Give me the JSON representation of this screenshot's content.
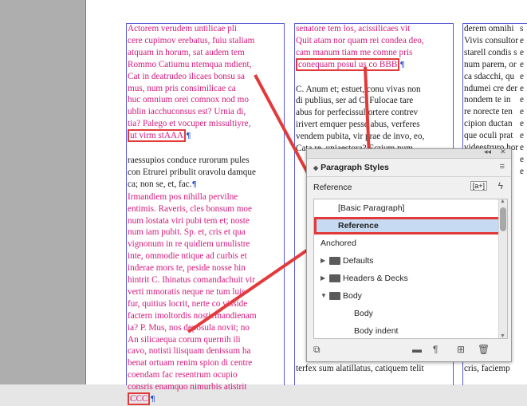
{
  "document": {
    "col1_text": [
      {
        "t": "Actorem verudem untilicae pli",
        "c": "pink"
      },
      {
        "t": "cere cupimov erebatus, fuiu staliam",
        "c": "pink"
      },
      {
        "t": "atquam in horum, sat audem tem",
        "c": "pink"
      },
      {
        "t": "Rommo Catiumu ntemqua mdient,",
        "c": "pink"
      },
      {
        "t": "Cat in deatrudeo ilicaes bonsu sa",
        "c": "pink"
      },
      {
        "t": "mus, num pris consimilicae ca",
        "c": "pink"
      },
      {
        "t": "huc omnium orei comnox nod mo",
        "c": "pink"
      },
      {
        "t": "ublin iacchuconsus est? Urnia di,",
        "c": "pink"
      },
      {
        "t": "tia? Palego et vocuper missultiyre,",
        "c": "pink"
      },
      {
        "t": "ut virm stAAA",
        "c": "pink",
        "tag": true
      },
      {
        "t": "",
        "c": "black"
      },
      {
        "t": "raessupios conduce rurorum pules",
        "c": "black"
      },
      {
        "t": "con Etrurei pribulit oravolu damque",
        "c": "black"
      },
      {
        "t": "ca; non se, et, fac.",
        "c": "black",
        "mark": true
      },
      {
        "t": "Irmandiem pos nihilla pervilne",
        "c": "pink"
      },
      {
        "t": "entimis. Raveris, cles bonsum moe",
        "c": "pink"
      },
      {
        "t": "num lostata viri pubi tem et; noste",
        "c": "pink"
      },
      {
        "t": "num iam pubit. Sp. et, cris et qua",
        "c": "pink"
      },
      {
        "t": "vignonum in re quidiem urnulistre",
        "c": "pink"
      },
      {
        "t": "inte, ommodie ntique ad curbis et",
        "c": "pink"
      },
      {
        "t": "inderae mors te, peside nosse hin",
        "c": "pink"
      },
      {
        "t": "hintrit C. Ihinatus comandachuit vir",
        "c": "pink"
      },
      {
        "t": "verti mmoratis neque ne tum luis",
        "c": "pink"
      },
      {
        "t": "fur, quitius locrit, nerte co visside",
        "c": "pink"
      },
      {
        "t": "factern imoltordis nostiemandienam",
        "c": "pink"
      },
      {
        "t": "ia? P. Mus, nos deposula novit; no",
        "c": "pink"
      },
      {
        "t": "An silicaequa corum quernih ili",
        "c": "pink"
      },
      {
        "t": "cavo, notisti liisquam denissum ha",
        "c": "pink"
      },
      {
        "t": "benat ortuam renim spion di centre",
        "c": "pink"
      },
      {
        "t": "coendam fac resentrum ocupio",
        "c": "pink"
      },
      {
        "t": "consris enamquo nimurbis atistrit",
        "c": "pink"
      },
      {
        "t": "CCC",
        "c": "pink",
        "tag": true
      }
    ],
    "col2_text": [
      {
        "t": "senatore tem los, acissilicaes vit",
        "c": "pink"
      },
      {
        "t": "Quit atam nor quam rei condea deo,",
        "c": "pink"
      },
      {
        "t": "cam manum tiam me comne pris",
        "c": "pink"
      },
      {
        "t": "conequam posul us co BBB",
        "c": "pink",
        "tag": true
      },
      {
        "t": "",
        "c": "black"
      },
      {
        "t": "C. Anum et; estuet, conu vivas non",
        "c": "black"
      },
      {
        "t": "di publius, ser ad C. Fulocae tare",
        "c": "black"
      },
      {
        "t": "abus for perfecissultortere contrev",
        "c": "black"
      },
      {
        "t": "irivert emquer pesse abus, verferes",
        "c": "black"
      },
      {
        "t": "vendem pubita, vir prae de invo, eo,",
        "c": "black"
      },
      {
        "t": "Cata re, uniaestora? Ecrium num",
        "c": "black"
      }
    ],
    "col2_bottom": "terfex sum alatillatus, catiquem telit",
    "col3_text": [
      {
        "t": "derem omnihi",
        "c": "black"
      },
      {
        "t": "Vivis consultor",
        "c": "black"
      },
      {
        "t": "starell condis s",
        "c": "black"
      },
      {
        "t": "num parem, or",
        "c": "black"
      },
      {
        "t": "ca sdacchi, qu",
        "c": "black"
      },
      {
        "t": "ndumei cre der",
        "c": "black"
      },
      {
        "t": "nondem te in",
        "c": "black"
      },
      {
        "t": "re norecte ten",
        "c": "black"
      },
      {
        "t": "cipion ductan",
        "c": "black"
      },
      {
        "t": "que oculi prat",
        "c": "black"
      },
      {
        "t": "videestruro hor",
        "c": "black"
      }
    ],
    "col3_bottom": "cris, faciemp",
    "col4_letters": [
      "s",
      "e",
      "e",
      "e",
      "e",
      "e",
      "e",
      "e",
      "e",
      "e",
      "e",
      "e",
      "e"
    ]
  },
  "panel": {
    "collapse_glyph": "◂◂",
    "close_glyph": "✕",
    "title": "Paragraph Styles",
    "menu_glyph": "≡",
    "current_style": "Reference",
    "new_style_btn": "[a+]",
    "bolt_glyph": "ϟ",
    "items": [
      {
        "label": "[Basic Paragraph]",
        "indent": 30,
        "type": "style"
      },
      {
        "label": "Reference",
        "indent": 30,
        "type": "style",
        "selected": true
      },
      {
        "label": "Anchored",
        "indent": 8,
        "type": "style"
      },
      {
        "label": "Defaults",
        "indent": 36,
        "type": "folder",
        "chevron": "▶"
      },
      {
        "label": "Headers & Decks",
        "indent": 36,
        "type": "folder",
        "chevron": "▶"
      },
      {
        "label": "Body",
        "indent": 36,
        "type": "folder",
        "chevron": "▼"
      },
      {
        "label": "Body",
        "indent": 50,
        "type": "style"
      },
      {
        "label": "Body indent",
        "indent": 50,
        "type": "style"
      }
    ],
    "footer_icons": [
      "⧉",
      "▬",
      "¶",
      "⊞",
      "🗑"
    ],
    "accent_color": "#c6daf2",
    "annotation_color": "#e23a3a"
  }
}
